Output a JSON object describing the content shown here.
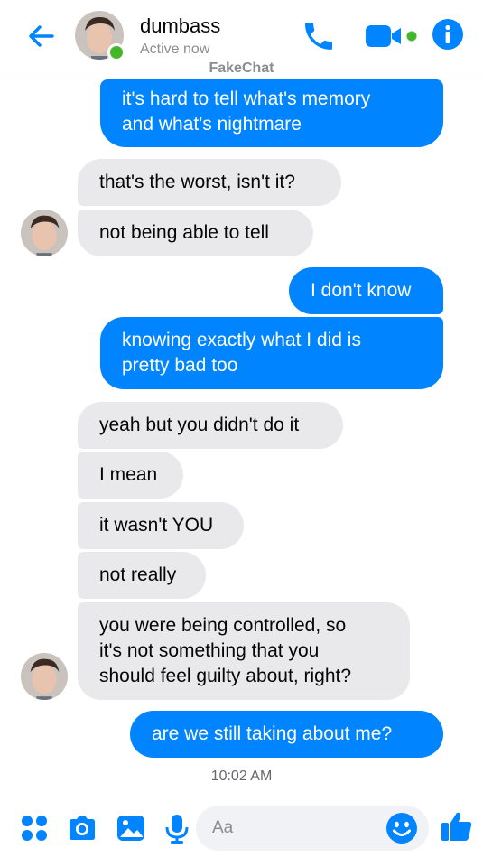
{
  "header": {
    "contact_name": "dumbass",
    "status": "Active now",
    "brand": "FakeChat",
    "icons": [
      "back-arrow-icon",
      "phone-icon",
      "video-camera-icon",
      "info-icon"
    ]
  },
  "messages": [
    {
      "side": "out",
      "text_lines": [
        "it's hard to tell what's memory",
        "and what's nightmare"
      ]
    },
    {
      "side": "in",
      "text_lines": [
        "that's the worst, isn't it?"
      ]
    },
    {
      "side": "in",
      "text_lines": [
        "not being able to tell"
      ]
    },
    {
      "side": "out",
      "text_lines": [
        "I don't know"
      ]
    },
    {
      "side": "out",
      "text_lines": [
        "knowing exactly what I did is",
        "pretty bad too"
      ]
    },
    {
      "side": "in",
      "text_lines": [
        "yeah but you didn't do it"
      ]
    },
    {
      "side": "in",
      "text_lines": [
        "I mean"
      ]
    },
    {
      "side": "in",
      "text_lines": [
        "it wasn't YOU"
      ]
    },
    {
      "side": "in",
      "text_lines": [
        "not really"
      ]
    },
    {
      "side": "in",
      "text_lines": [
        "you were being controlled, so",
        "it's not something that you",
        "should feel guilty about, right?"
      ]
    },
    {
      "side": "out",
      "text_lines": [
        "are we still taking about me?"
      ]
    }
  ],
  "timestamp": "10:02 AM",
  "composer": {
    "placeholder": "Aa",
    "value": "",
    "icons": [
      "apps-grid-icon",
      "camera-icon",
      "image-icon",
      "microphone-icon",
      "emoji-icon",
      "thumbs-up-icon"
    ]
  },
  "colors": {
    "accent": "#0084ff",
    "incoming_bubble": "#e9e9eb",
    "online": "#42b72a"
  }
}
